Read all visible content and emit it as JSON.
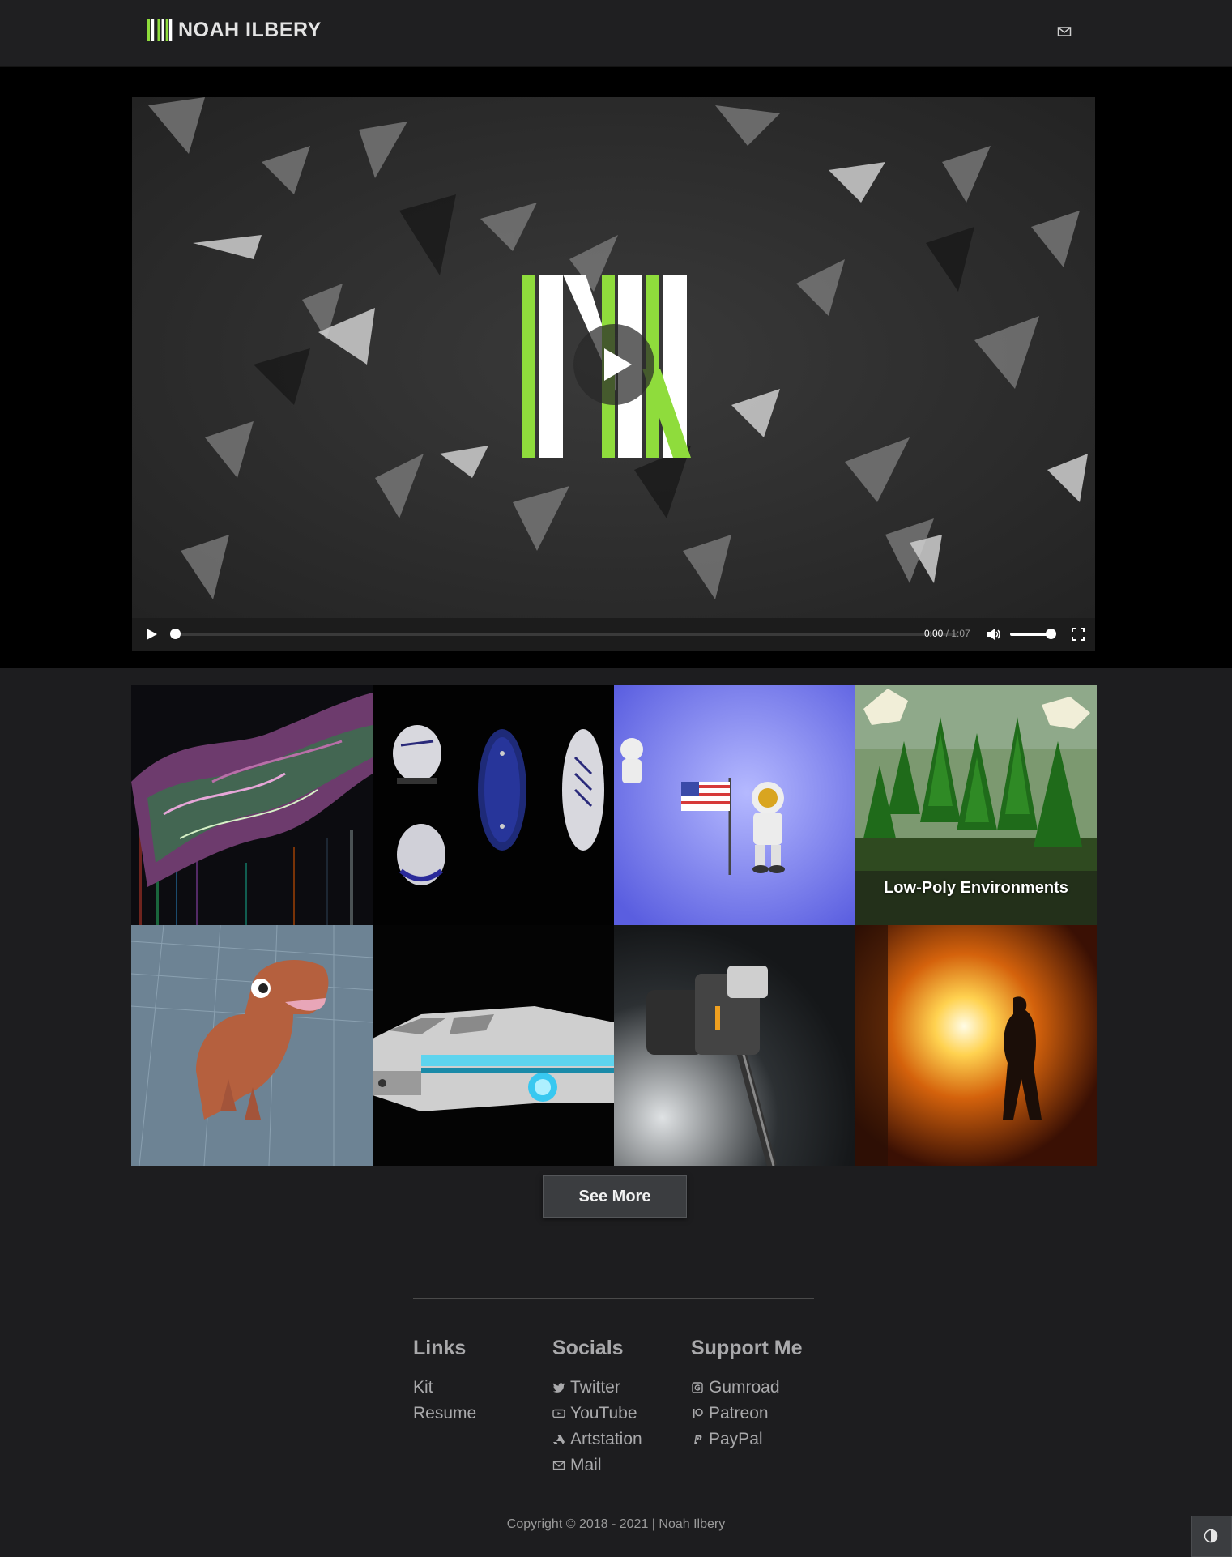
{
  "header": {
    "brand_name": "NOAH ILBERY",
    "mail_icon": "mail-icon"
  },
  "video": {
    "current_time": "0:00",
    "separator": " / ",
    "duration": "1:07",
    "progress": 0.0,
    "volume": 0.9
  },
  "gallery": {
    "tiles": [
      {
        "subject": "abstract-fractal",
        "caption": ""
      },
      {
        "subject": "football-boots",
        "caption": ""
      },
      {
        "subject": "astronauts-flag",
        "caption": ""
      },
      {
        "subject": "low-poly-forest",
        "caption": "Low-Poly Environments"
      },
      {
        "subject": "cartoon-dinosaur",
        "caption": ""
      },
      {
        "subject": "spaceship",
        "caption": ""
      },
      {
        "subject": "hammer",
        "caption": ""
      },
      {
        "subject": "fire-silhouette",
        "caption": ""
      }
    ],
    "see_more_label": "See More"
  },
  "footer": {
    "links": {
      "heading": "Links",
      "items": [
        {
          "label": "Kit"
        },
        {
          "label": "Resume"
        }
      ]
    },
    "socials": {
      "heading": "Socials",
      "items": [
        {
          "label": "Twitter",
          "icon": "twitter-icon"
        },
        {
          "label": "YouTube",
          "icon": "youtube-icon"
        },
        {
          "label": "Artstation",
          "icon": "artstation-icon"
        },
        {
          "label": "Mail",
          "icon": "mail-icon"
        }
      ]
    },
    "support": {
      "heading": "Support Me",
      "items": [
        {
          "label": "Gumroad",
          "icon": "gumroad-icon"
        },
        {
          "label": "Patreon",
          "icon": "patreon-icon"
        },
        {
          "label": "PayPal",
          "icon": "paypal-icon"
        }
      ]
    },
    "copyright": "Copyright © 2018 - 2021 | Noah Ilbery"
  },
  "colors": {
    "accent": "#8fdc3c",
    "page_bg": "#1d1d1f",
    "video_band": "#000000",
    "button_bg": "#3b3d40"
  }
}
